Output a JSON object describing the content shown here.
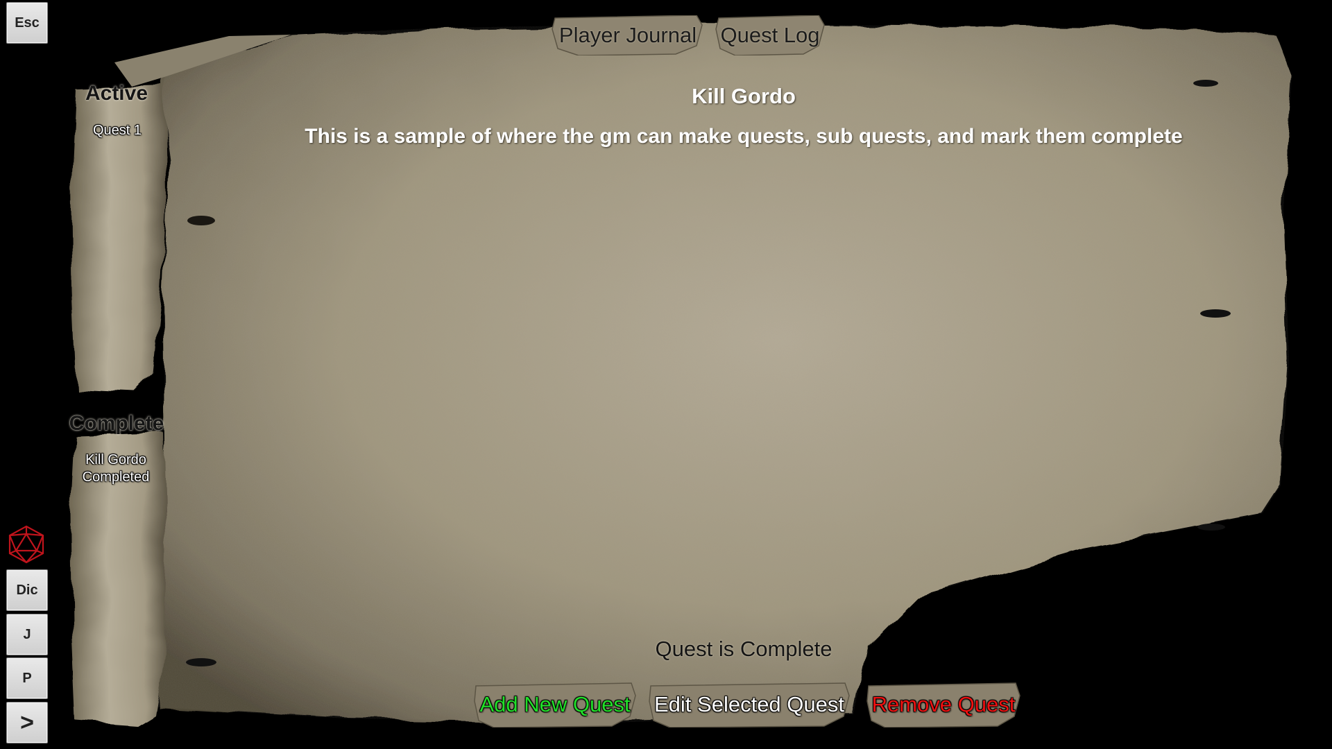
{
  "side_toolbar": {
    "esc_label": "Esc",
    "dice_label": "Dic",
    "journal_label": "J",
    "player_label": "P",
    "expand_label": ">",
    "dice_icon": "d20-icon",
    "dice_icon_color": "#c0141c"
  },
  "tabs": [
    {
      "label": "Player Journal"
    },
    {
      "label": "Quest Log"
    }
  ],
  "lists": {
    "active": {
      "heading": "Active",
      "items": [
        "Quest 1"
      ]
    },
    "complete": {
      "heading": "Complete",
      "items": [
        {
          "line1": "Kill Gordo",
          "line2": "Completed"
        }
      ]
    }
  },
  "quest": {
    "title": "Kill Gordo",
    "description": "This is a sample of where the gm can make quests, sub quests, and mark them complete",
    "status": "Quest is Complete"
  },
  "actions": {
    "add_label": "Add New Quest",
    "add_color": "#22e02a",
    "edit_label": "Edit Selected Quest",
    "edit_color": "#ffffff",
    "remove_label": "Remove Quest",
    "remove_color": "#ee1111"
  },
  "colors": {
    "parchment": "#9e9582",
    "parchment_light": "#b3aa95",
    "parchment_dark": "#5e5748",
    "background": "#000000"
  }
}
